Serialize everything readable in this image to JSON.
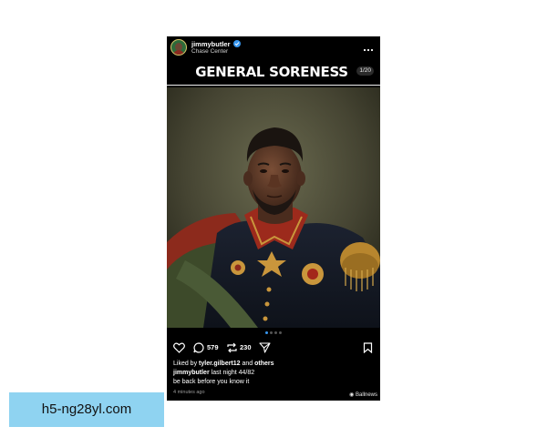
{
  "post": {
    "username": "jimmybutler",
    "location": "Chase Center",
    "title": "GENERAL SORENESS",
    "slide_counter": "1/20",
    "icons": {
      "avatar": "avatar",
      "verified": "verified-badge-icon",
      "more": "more-options-icon",
      "mute": "muted-speaker-icon",
      "like": "heart-icon",
      "comment": "comment-bubble-icon",
      "repost": "repost-icon",
      "share": "send-icon",
      "save": "bookmark-icon"
    },
    "carousel": {
      "total_dots": 4,
      "active_index": 0
    },
    "comment_count": "579",
    "repost_count": "230",
    "liked_by_prefix": "Liked by",
    "liked_by_user": "tyler.gilbert12",
    "liked_by_and": "and",
    "liked_by_others": "others",
    "caption_user": "jimmybutler",
    "caption_text": "last night 44/82",
    "caption_line2": "be back before you know it",
    "time_ago": "4 minutes ago",
    "watermark": "Ballnews"
  },
  "url_label": "h5-ng28yl.com",
  "colors": {
    "page_bg": "#ffffff",
    "post_bg": "#000000",
    "verified": "#3897f0",
    "active_dot": "#3897f0",
    "url_box": "#8fd3f1"
  }
}
